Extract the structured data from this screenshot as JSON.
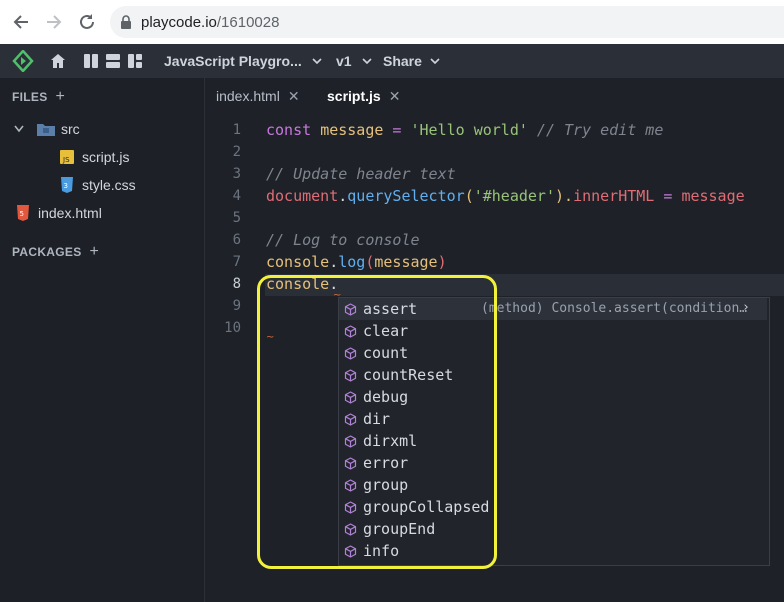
{
  "browser": {
    "url_host": "playcode.io",
    "url_path": "/1610028"
  },
  "header": {
    "project_name": "JavaScript Playgro...",
    "version": "v1",
    "share_label": "Share"
  },
  "sidebar": {
    "files_heading": "FILES",
    "folder": "src",
    "files": [
      "script.js",
      "style.css"
    ],
    "root_file": "index.html",
    "packages_heading": "PACKAGES"
  },
  "tabs": [
    {
      "label": "index.html",
      "close": "✕"
    },
    {
      "label": "script.js",
      "close": "✕"
    }
  ],
  "line_numbers": [
    "1",
    "2",
    "3",
    "4",
    "5",
    "6",
    "7",
    "8",
    "9",
    "10"
  ],
  "code": {
    "l1": {
      "kw": "const",
      "sp1": " ",
      "var": "message",
      "op": " = ",
      "str": "'Hello world'",
      "cm": " // Try edit me"
    },
    "l3": {
      "cm": "// Update header text"
    },
    "l4": {
      "obj": "document",
      "dot1": ".",
      "fn": "querySelector",
      "p1": "(",
      "str": "'#header'",
      "p2": ").",
      "prop": "innerHTML",
      "op": " = ",
      "var": "message"
    },
    "l6": {
      "cm": "// Log to console"
    },
    "l7": {
      "obj": "console",
      "dot": ".",
      "fn": "log",
      "p1": "(",
      "var": "message",
      "p2": ")"
    },
    "l8": {
      "obj": "console",
      "dot": "."
    }
  },
  "suggest": {
    "items": [
      "assert",
      "clear",
      "count",
      "countReset",
      "debug",
      "dir",
      "dirxml",
      "error",
      "group",
      "groupCollapsed",
      "groupEnd",
      "info"
    ],
    "selected_detail": "(method) Console.assert(condition…",
    "chevron": "›"
  },
  "colors": {
    "accent": "#f2f23a",
    "method_icon": "#b180d7"
  }
}
